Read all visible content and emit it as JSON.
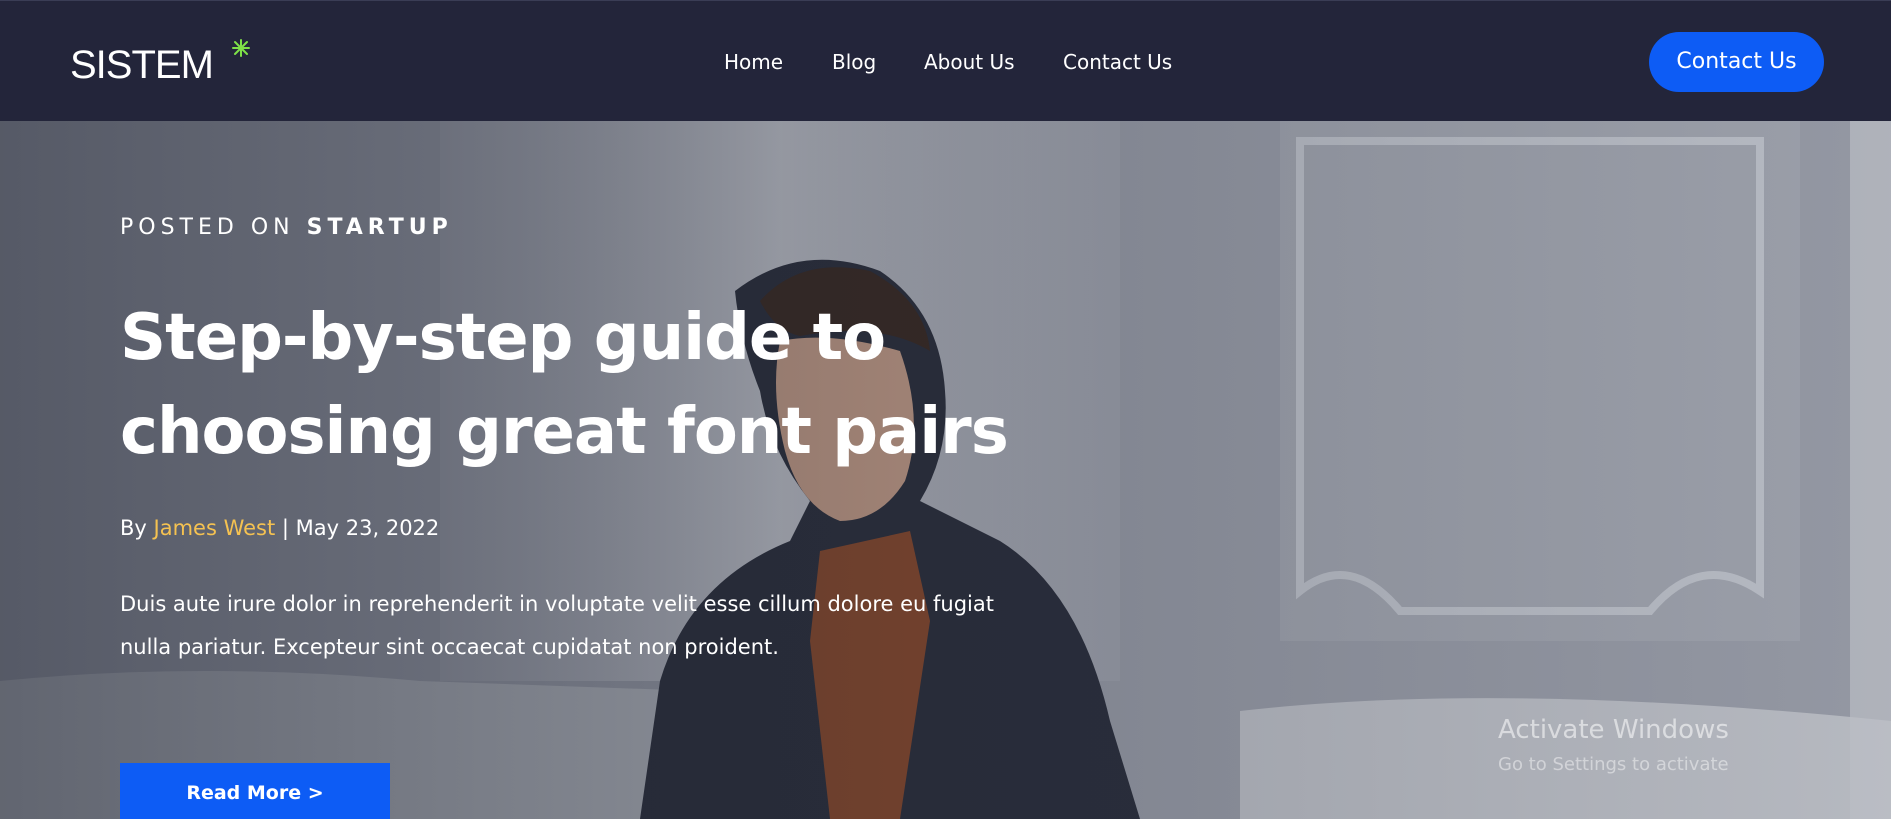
{
  "navbar": {
    "logo_text": "SISTEM",
    "logo_icon": "sparkle-star-icon",
    "logo_accent_color": "#7ee048",
    "links": [
      {
        "label": "Home"
      },
      {
        "label": "Blog"
      },
      {
        "label": "About Us"
      },
      {
        "label": "Contact Us"
      }
    ],
    "cta_label": "Contact Us",
    "background_color": "#23253a",
    "cta_color": "#0d5cf5"
  },
  "hero": {
    "category_prefix": "POSTED ON",
    "category_name": "STARTUP",
    "headline": "Step-by-step guide to choosing great font pairs",
    "byline_prefix": "By",
    "author": "James West",
    "separator": "|",
    "date": "May 23, 2022",
    "excerpt": "Duis aute irure dolor in reprehenderit in voluptate velit esse cillum dolore eu fugiat nulla pariatur. Excepteur sint occaecat cupidatat non proident.",
    "read_more_label": "Read More >",
    "author_color": "#f5c251",
    "button_color": "#0d5cf5"
  },
  "watermark": {
    "title": "Activate Windows",
    "subtitle": "Go to Settings to activate"
  }
}
